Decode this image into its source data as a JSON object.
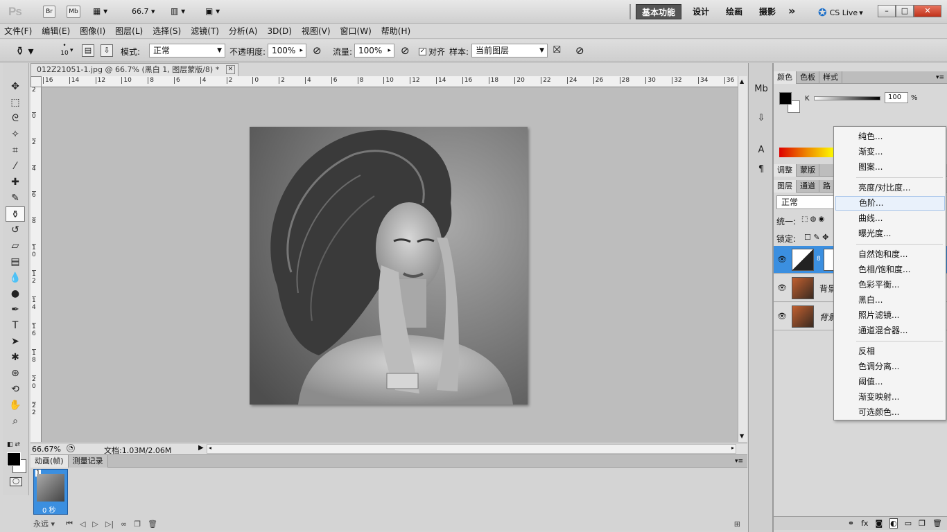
{
  "titlebar": {
    "logo": "Ps",
    "bridge_label": "Br",
    "minibridge_label": "Mb",
    "zoom_value": "66.7",
    "workspaces": [
      "基本功能",
      "设计",
      "绘画",
      "摄影"
    ],
    "more_label": "»",
    "cslive": "CS Live",
    "win_min": "–",
    "win_max": "□",
    "win_close": "✕"
  },
  "menubar": [
    "文件(F)",
    "编辑(E)",
    "图像(I)",
    "图层(L)",
    "选择(S)",
    "滤镜(T)",
    "分析(A)",
    "3D(D)",
    "视图(V)",
    "窗口(W)",
    "帮助(H)"
  ],
  "options": {
    "brush_size": "10",
    "mode_label": "模式:",
    "mode_value": "正常",
    "opacity_label": "不透明度:",
    "opacity_value": "100%",
    "flow_label": "流量:",
    "flow_value": "100%",
    "align_label": "对齐",
    "sample_label": "样本:",
    "sample_value": "当前图层"
  },
  "document": {
    "tab_title": "012Z21051-1.jpg @ 66.7% (黑白 1, 图层蒙版/8) *",
    "close_label": "✕",
    "h_ruler": [
      "16",
      "14",
      "12",
      "10",
      "8",
      "6",
      "4",
      "2",
      "0",
      "2",
      "4",
      "6",
      "8",
      "10",
      "12",
      "14",
      "16",
      "18",
      "20",
      "22",
      "24",
      "26",
      "28",
      "30",
      "32",
      "34",
      "36"
    ],
    "v_ruler": [
      "2",
      "0",
      "2",
      "4",
      "6",
      "8",
      "1\n0",
      "1\n2",
      "1\n4",
      "1\n6",
      "1\n8",
      "2\n0",
      "2\n2"
    ]
  },
  "status": {
    "zoom": "66.67%",
    "doc_info": "文档:1.03M/2.06M"
  },
  "animation": {
    "tabs": [
      "动画(帧)",
      "测量记录"
    ],
    "frame_number": "1",
    "frame_delay": "0 秒",
    "loop": "永远"
  },
  "color_panel": {
    "tabs": [
      "颜色",
      "色板",
      "样式"
    ],
    "channel_label": "K",
    "channel_value": "100",
    "percent": "%"
  },
  "adjust_panel": {
    "tabs": [
      "调整",
      "蒙版"
    ]
  },
  "layers_panel": {
    "tabs": [
      "图层",
      "通道",
      "路"
    ],
    "blend_mode": "正常",
    "unify_label": "统一:",
    "lock_label": "锁定:",
    "layers": [
      {
        "name": "",
        "type": "adjustment"
      },
      {
        "name": "背景",
        "type": "photo"
      },
      {
        "name": "背景",
        "type": "photo"
      }
    ]
  },
  "context_menu": {
    "groups": [
      [
        "纯色...",
        "渐变...",
        "图案..."
      ],
      [
        "亮度/对比度...",
        "色阶...",
        "曲线...",
        "曝光度..."
      ],
      [
        "自然饱和度...",
        "色相/饱和度...",
        "色彩平衡...",
        "黑白...",
        "照片滤镜...",
        "通道混合器..."
      ],
      [
        "反相",
        "色调分离...",
        "阈值...",
        "渐变映射...",
        "可选颜色..."
      ]
    ],
    "highlighted": "色阶..."
  }
}
